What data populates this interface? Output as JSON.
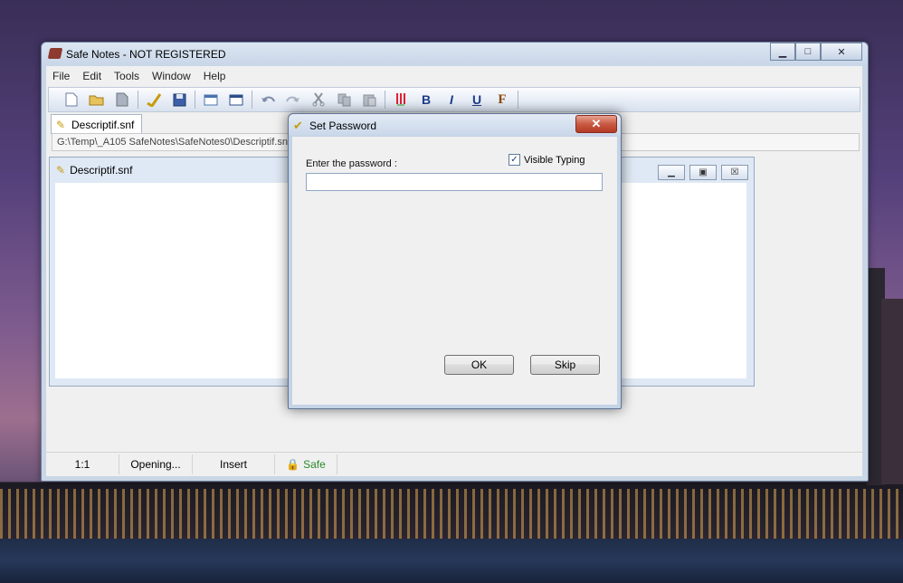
{
  "window": {
    "title": "Safe Notes - NOT REGISTERED",
    "controls": {
      "minimize": "▁",
      "maximize": "□",
      "close": "✕"
    }
  },
  "menu": [
    "File",
    "Edit",
    "Tools",
    "Window",
    "Help"
  ],
  "toolbar": {
    "icons": [
      "new-icon",
      "open-icon",
      "close-doc-icon",
      "protect-icon",
      "save-icon",
      "cascade-icon",
      "tile-icon",
      "undo-icon",
      "redo-icon",
      "cut-icon",
      "copy-icon",
      "paste-icon",
      "color-icon",
      "bold-icon",
      "italic-icon",
      "underline-icon",
      "font-icon"
    ],
    "bold": "B",
    "italic": "I",
    "underline": "U",
    "font": "F"
  },
  "tab": {
    "label": "Descriptif.snf"
  },
  "path": "G:\\Temp\\_A105 SafeNotes\\SafeNotes0\\Descriptif.snf",
  "mdi_window": {
    "title": "Descriptif.snf",
    "controls": {
      "minimize": "▁",
      "restore": "▣",
      "close": "☒"
    }
  },
  "statusbar": {
    "position": "1:1",
    "state": "Opening...",
    "mode": "Insert",
    "safe": "Safe"
  },
  "dialog": {
    "title": "Set Password",
    "close": "✕",
    "password_label": "Enter the password :",
    "password_value": "",
    "visible_typing_label": "Visible Typing",
    "visible_typing_checked": "✓",
    "ok_label": "OK",
    "skip_label": "Skip"
  },
  "colors": {
    "accent": "#c79c0c",
    "safe": "#2a8a2a",
    "close_button": "#c85a44"
  }
}
